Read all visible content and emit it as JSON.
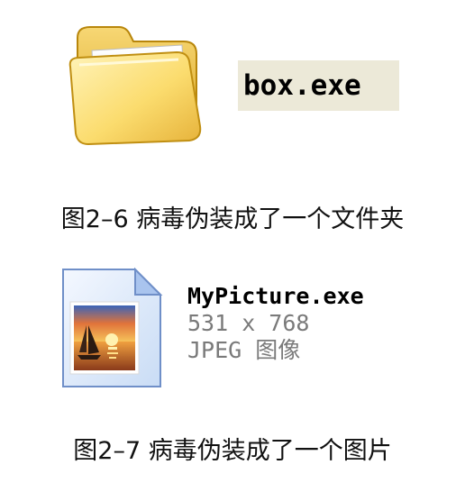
{
  "figure1": {
    "icon": "folder-icon",
    "filename": "box.exe",
    "caption": "图2–6 病毒伪装成了一个文件夹"
  },
  "figure2": {
    "icon": "jpeg-image-icon",
    "filename": "MyPicture.exe",
    "dimensions": "531 x 768",
    "type": "JPEG 图像",
    "caption": "图2–7 病毒伪装成了一个图片"
  }
}
